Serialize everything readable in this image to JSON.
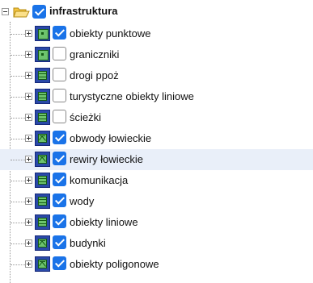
{
  "tree": {
    "root": {
      "label": "infrastruktura",
      "checked": true,
      "expanded": true
    },
    "items": [
      {
        "label": "obiekty punktowe",
        "checked": true,
        "icon": "point-layer-icon"
      },
      {
        "label": "graniczniki",
        "checked": false,
        "icon": "point-layer-icon"
      },
      {
        "label": "drogi ppoż",
        "checked": false,
        "icon": "line-layer-icon"
      },
      {
        "label": "turystyczne obiekty liniowe",
        "checked": false,
        "icon": "line-layer-icon"
      },
      {
        "label": "ścieżki",
        "checked": false,
        "icon": "line-layer-icon"
      },
      {
        "label": "obwody łowieckie",
        "checked": true,
        "icon": "polygon-layer-icon"
      },
      {
        "label": "rewiry łowieckie",
        "checked": true,
        "icon": "polygon-layer-icon",
        "selected": true
      },
      {
        "label": "komunikacja",
        "checked": true,
        "icon": "line-layer-icon"
      },
      {
        "label": "wody",
        "checked": true,
        "icon": "line-layer-icon"
      },
      {
        "label": "obiekty liniowe",
        "checked": true,
        "icon": "line-layer-icon"
      },
      {
        "label": "budynki",
        "checked": true,
        "icon": "polygon-layer-icon"
      },
      {
        "label": "obiekty poligonowe",
        "checked": true,
        "icon": "polygon-layer-icon"
      }
    ]
  },
  "colors": {
    "layer_icon_frame": "#2a49a8",
    "layer_icon_fill": "#6dc36d",
    "checkbox_checked": "#1a73e8",
    "selected_row": "#e9eff9",
    "folder": "#f5c542"
  }
}
